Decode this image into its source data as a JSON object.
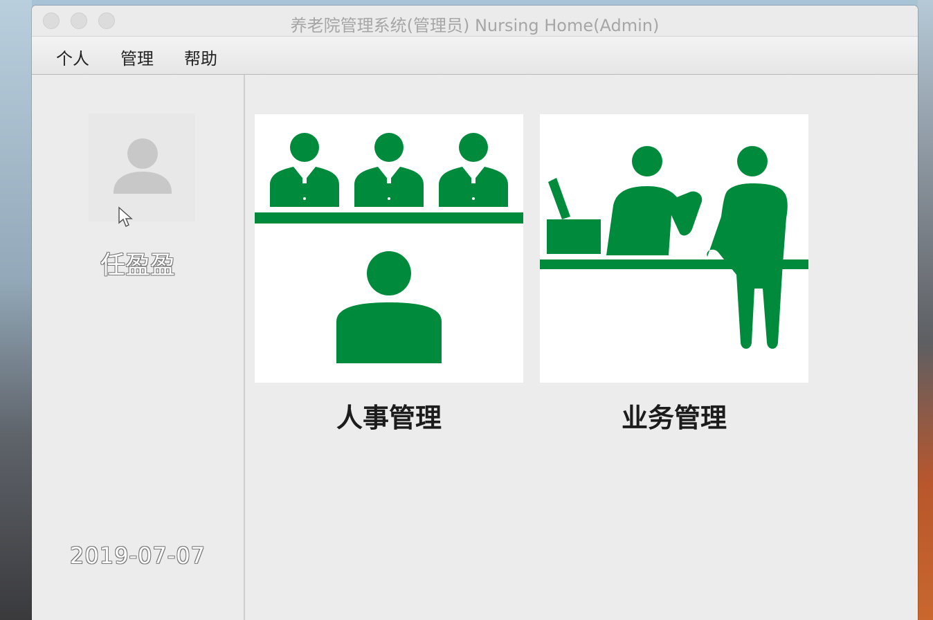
{
  "window": {
    "title": "养老院管理系统(管理员) Nursing Home(Admin)"
  },
  "menubar": {
    "items": [
      {
        "label": "个人"
      },
      {
        "label": "管理"
      },
      {
        "label": "帮助"
      }
    ]
  },
  "sidebar": {
    "user_name": "任盈盈",
    "date": "2019-07-07",
    "avatar_icon": "user-silhouette-icon"
  },
  "modules": [
    {
      "label": "人事管理",
      "icon": "staff-management-icon"
    },
    {
      "label": "业务管理",
      "icon": "service-counter-icon"
    }
  ],
  "colors": {
    "accent_green": "#008a3c",
    "window_bg": "#ececec"
  }
}
